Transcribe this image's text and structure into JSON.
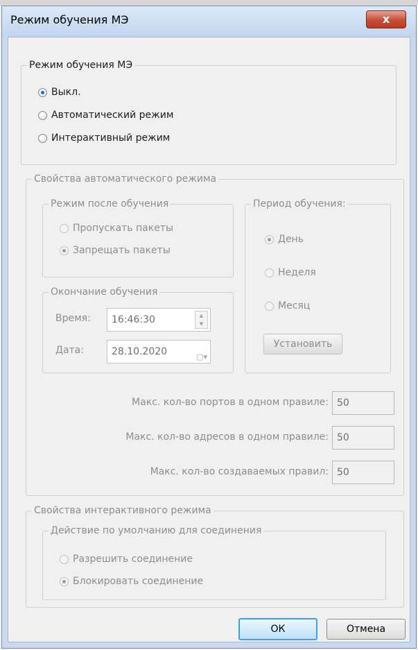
{
  "dialog": {
    "title": "Режим обучения МЭ",
    "close_glyph": "x",
    "close_icon": "close-icon"
  },
  "mode_group": {
    "caption": "Режим обучения МЭ",
    "options": [
      {
        "label": "Выкл.",
        "selected": true
      },
      {
        "label": "Автоматический режим",
        "selected": false
      },
      {
        "label": "Интерактивный режим",
        "selected": false
      }
    ]
  },
  "auto_props": {
    "caption": "Свойства автоматического режима",
    "after_learning": {
      "caption": "Режим после обучения",
      "options": [
        {
          "label": "Пропускать пакеты",
          "selected": false
        },
        {
          "label": "Запрещать пакеты",
          "selected": true
        }
      ]
    },
    "period": {
      "caption": "Период обучения:",
      "options": [
        {
          "label": "День",
          "selected": true
        },
        {
          "label": "Неделя",
          "selected": false
        },
        {
          "label": "Месяц",
          "selected": false
        }
      ],
      "set_button": "Установить"
    },
    "end_learning": {
      "caption": "Окончание обучения",
      "time_label": "Время:",
      "time_value": "16:46:30",
      "date_label": "Дата:",
      "date_value": "28.10.2020"
    },
    "limits": [
      {
        "label": "Макс. кол-во портов в одном правиле:",
        "value": "50"
      },
      {
        "label": "Макс. кол-во адресов в одном правиле:",
        "value": "50"
      },
      {
        "label": "Макс. кол-во создаваемых правил:",
        "value": "50"
      }
    ]
  },
  "interactive_props": {
    "caption": "Свойства интерактивного режима",
    "default_action": {
      "caption": "Действие по умолчанию для соединения",
      "options": [
        {
          "label": "Разрешить соединение",
          "selected": false
        },
        {
          "label": "Блокировать соединение",
          "selected": true
        }
      ]
    }
  },
  "buttons": {
    "ok": "ОК",
    "cancel": "Отмена"
  }
}
